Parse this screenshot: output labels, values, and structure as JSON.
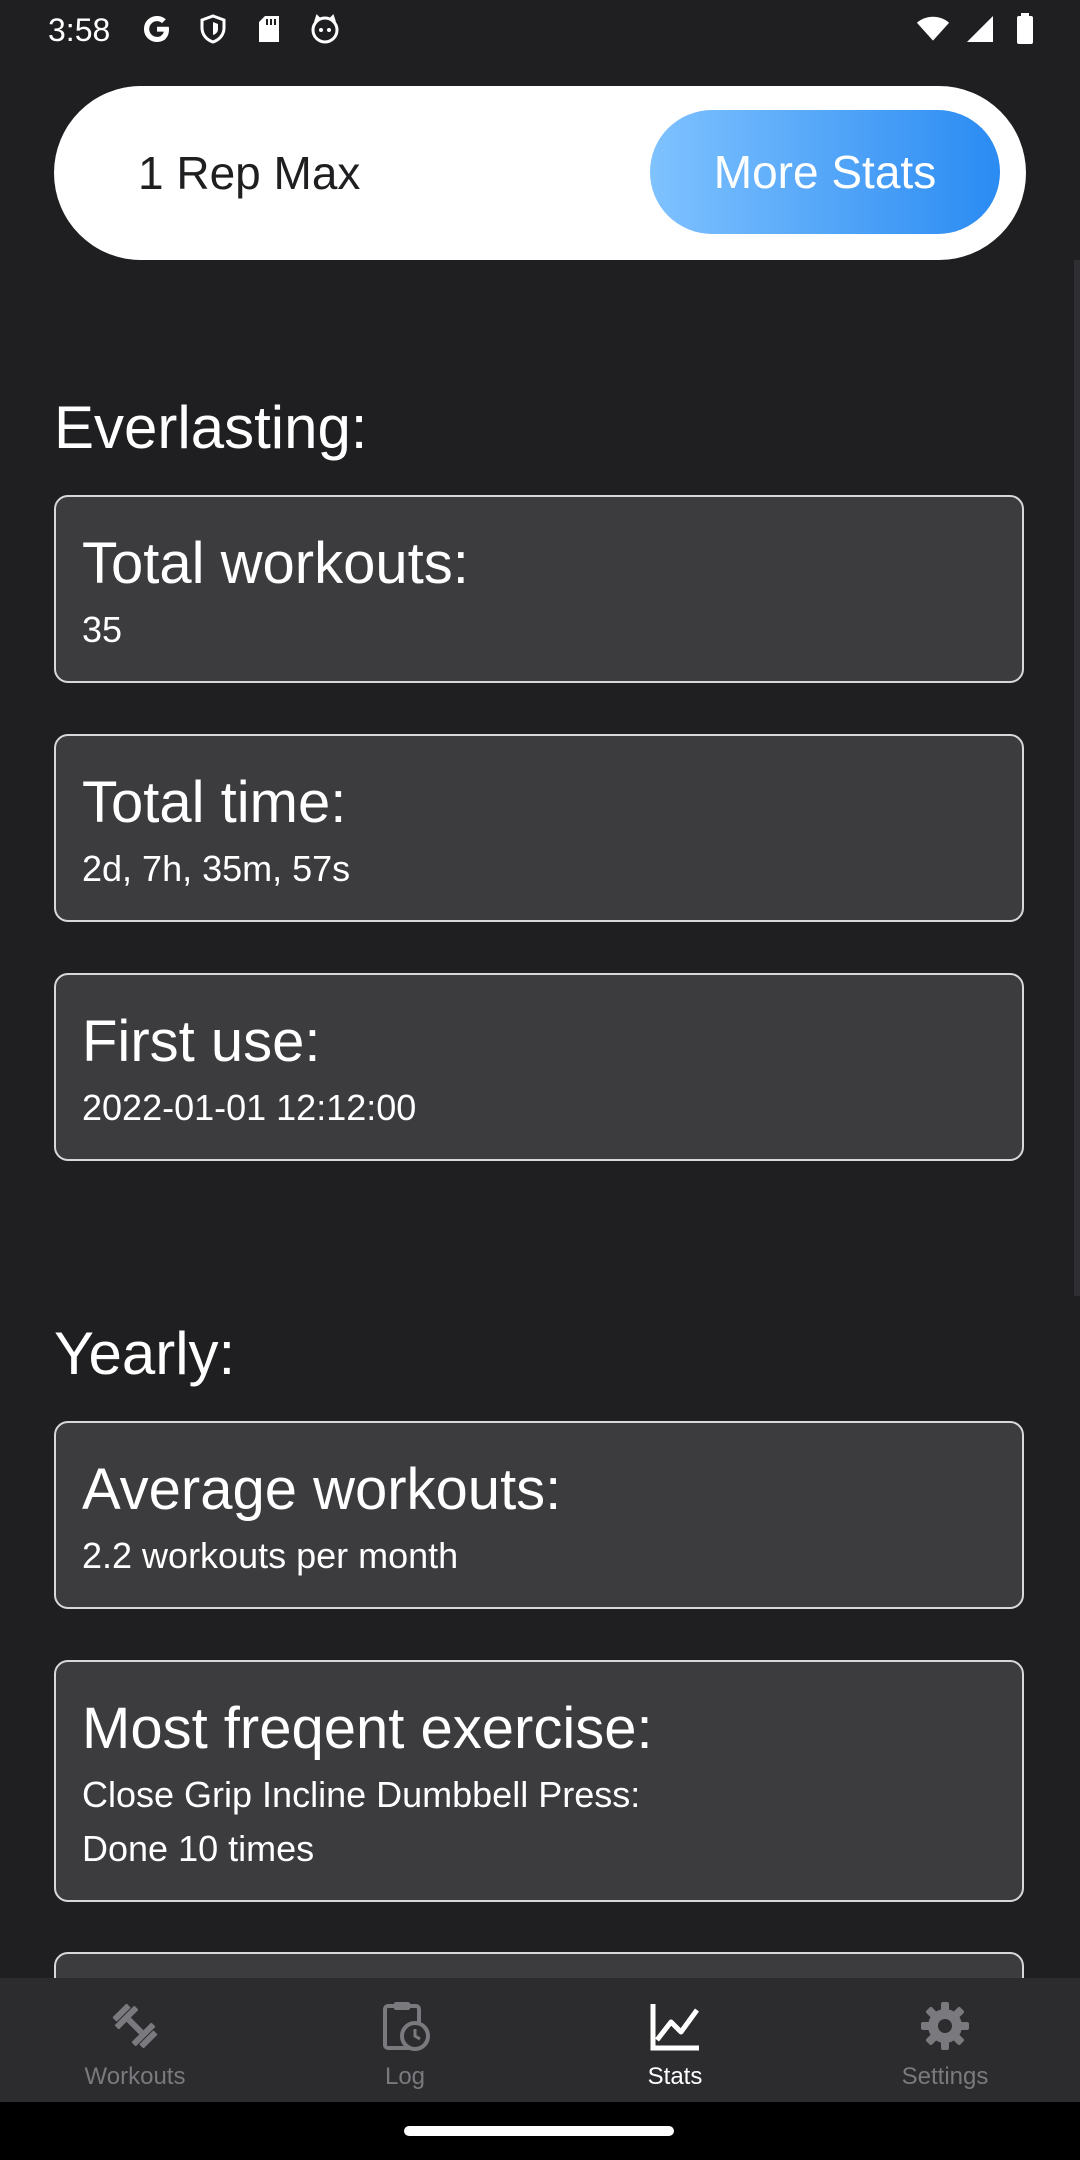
{
  "status_bar": {
    "time": "3:58",
    "left_icons": [
      "google-icon",
      "shield-icon",
      "sd-card-icon",
      "cat-icon"
    ],
    "right_icons": [
      "wifi-icon",
      "signal-icon",
      "battery-icon"
    ]
  },
  "header": {
    "left_label": "1 Rep Max",
    "right_label": "More Stats"
  },
  "sections": {
    "everlasting": {
      "heading": "Everlasting:",
      "cards": [
        {
          "title": "Total workouts:",
          "value": "35"
        },
        {
          "title": "Total time:",
          "value": "2d, 7h, 35m, 57s"
        },
        {
          "title": "First use:",
          "value": "2022-01-01 12:12:00"
        }
      ]
    },
    "yearly": {
      "heading": "Yearly:",
      "cards": [
        {
          "title": "Average workouts:",
          "value": "2.2 workouts per month"
        },
        {
          "title": "Most freqent exercise:",
          "value": "Close Grip Incline Dumbbell Press:",
          "value2": "Done 10 times"
        }
      ]
    }
  },
  "nav": {
    "items": [
      {
        "label": "Workouts",
        "icon": "dumbbell-icon",
        "active": false
      },
      {
        "label": "Log",
        "icon": "clipboard-clock-icon",
        "active": false
      },
      {
        "label": "Stats",
        "icon": "chart-line-icon",
        "active": true
      },
      {
        "label": "Settings",
        "icon": "gear-icon",
        "active": false
      }
    ]
  },
  "colors": {
    "background": "#1f1f21",
    "card": "#3c3c3f",
    "accent_start": "#7fc2ff",
    "accent_end": "#2a8bf2",
    "nav_inactive": "#7a7a7e"
  }
}
